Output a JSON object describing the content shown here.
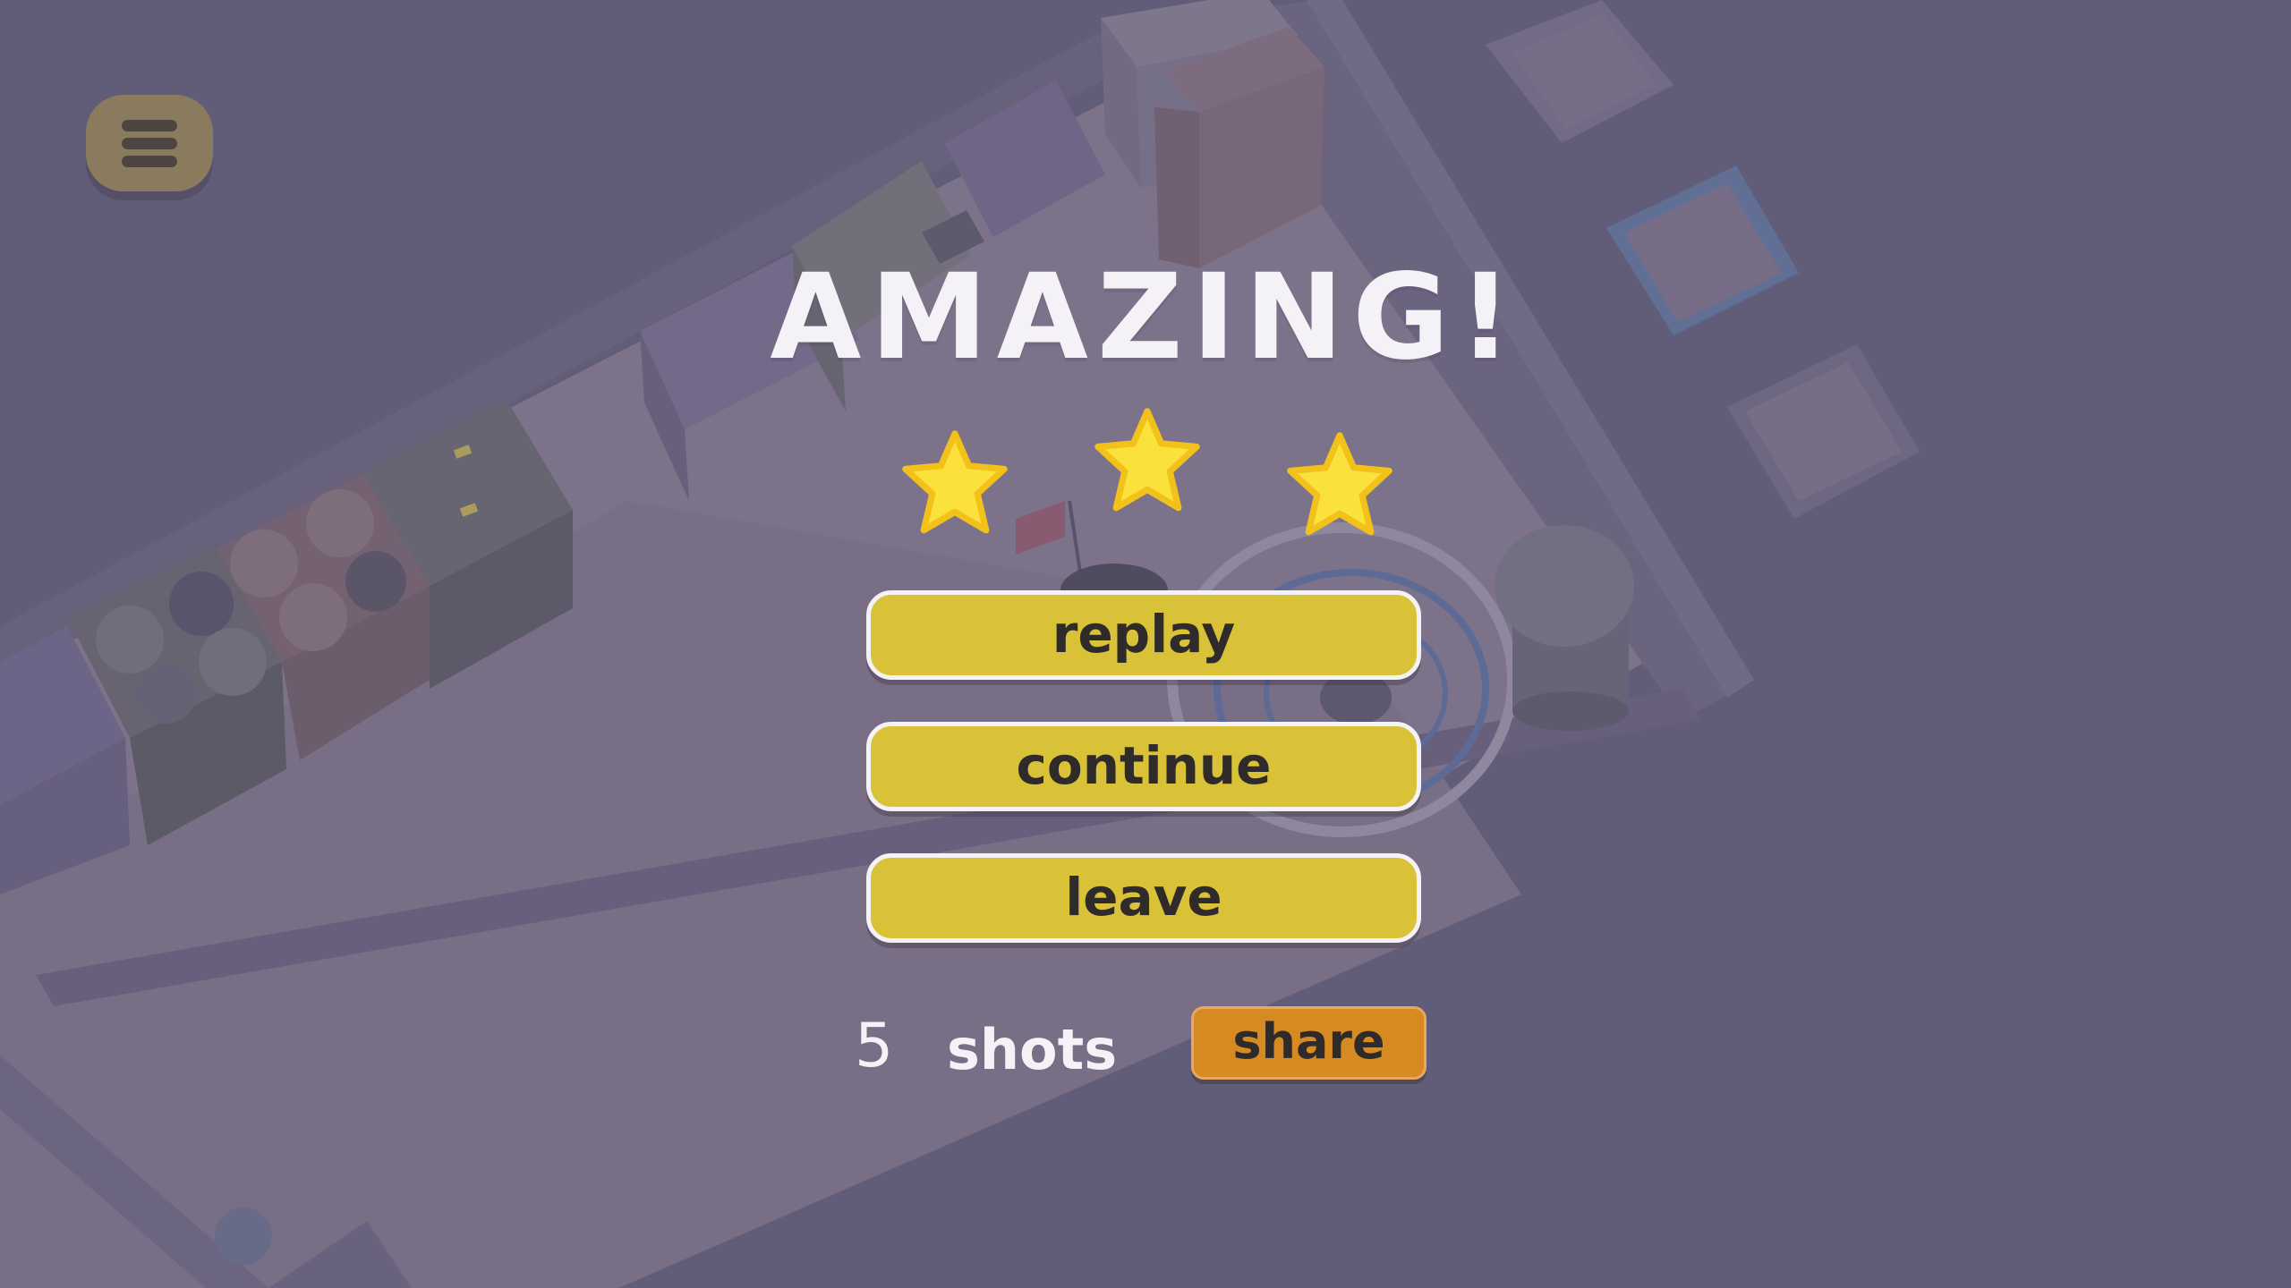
{
  "hud": {
    "menu_icon": "hamburger-menu-icon"
  },
  "result": {
    "title": "AMAZING!",
    "stars_earned": 3,
    "stars_total": 3,
    "star_color": "#fbe13c",
    "star_outline_color": "#f2c21b"
  },
  "buttons": {
    "replay_label": "replay",
    "continue_label": "continue",
    "leave_label": "leave",
    "button_color": "#d9c237"
  },
  "stats": {
    "shots_count": "5",
    "shots_label": "shots"
  },
  "share": {
    "label": "share",
    "color": "#d68a22"
  }
}
